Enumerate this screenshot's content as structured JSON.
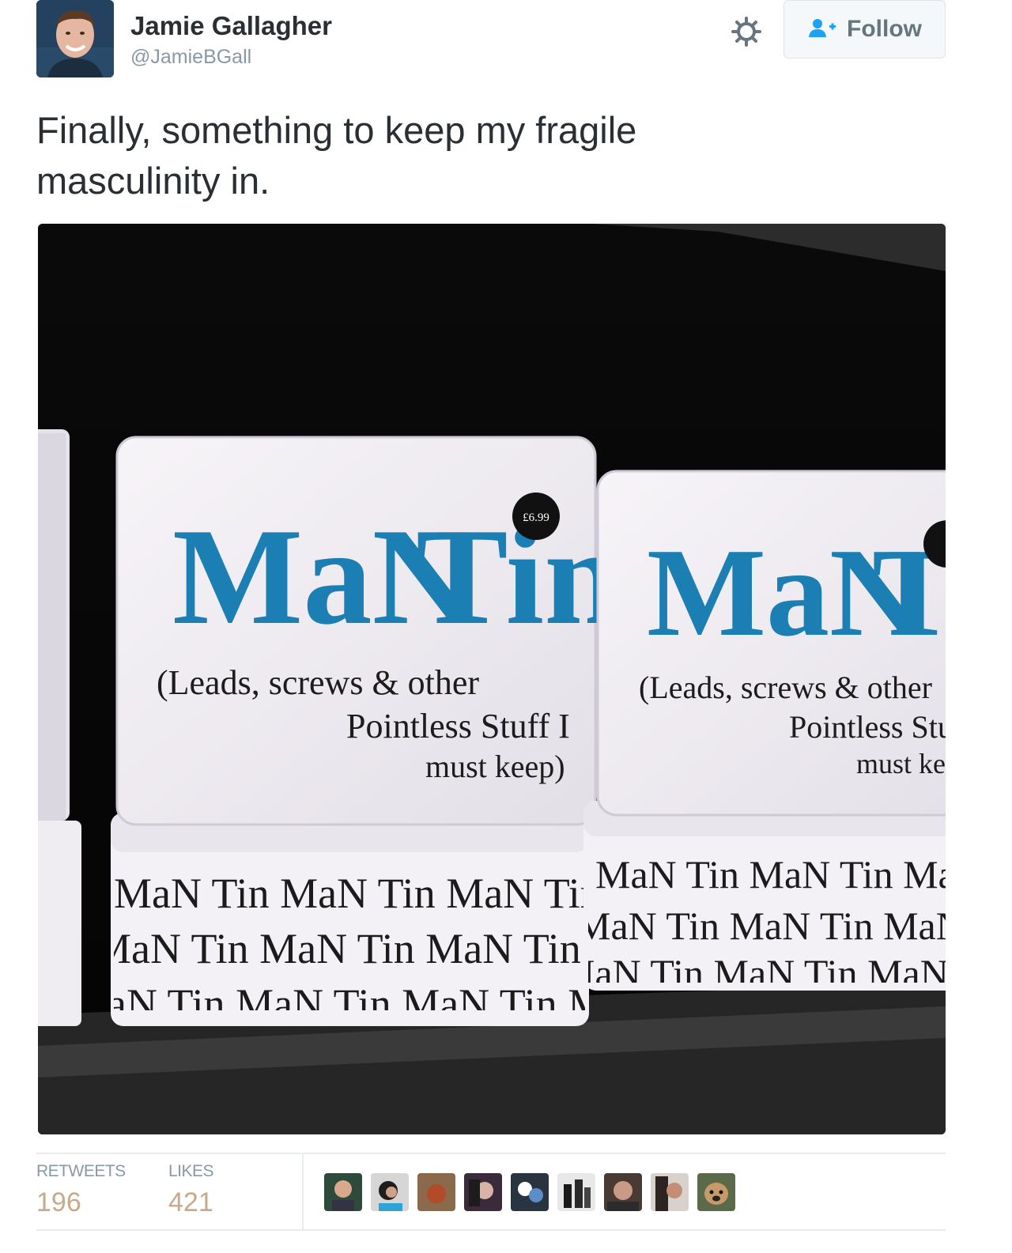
{
  "user": {
    "display_name": "Jamie Gallagher",
    "handle": "@JamieBGall"
  },
  "header": {
    "follow_label": "Follow",
    "settings_icon": "gear-icon",
    "follow_icon": "add-user-icon"
  },
  "tweet": {
    "text_line1": "Finally, something to keep my fragile",
    "text_line2": "masculinity in."
  },
  "photo": {
    "tin_brand_word1": "MaN",
    "tin_brand_word2": "Tin",
    "tin_price": "£6.99",
    "tin_sub_line1": "(Leads, screws & other",
    "tin_sub_line2": "Pointless Stuff I",
    "tin_sub_line3": "must keep)",
    "pattern_row": "MaN Tin MaN Tin MaN Tin MaN Tin MaN Tin MaN Tin MaN"
  },
  "stats": {
    "retweets_label": "RETWEETS",
    "retweets_value": "196",
    "likes_label": "LIKES",
    "likes_value": "421"
  },
  "colors": {
    "accent_blue": "#1b7fb3",
    "stat_value": "#c8aa8a",
    "muted": "#8899a6"
  }
}
